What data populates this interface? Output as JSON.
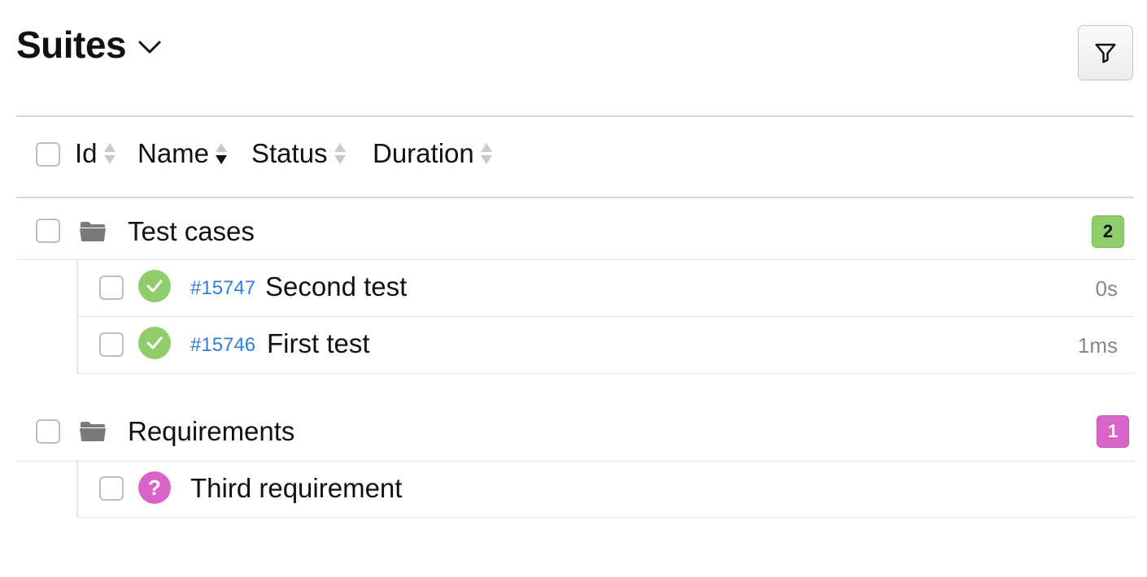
{
  "header": {
    "title": "Suites",
    "filter_icon": "filter-icon",
    "chevron_icon": "chevron-down-icon"
  },
  "columns": [
    {
      "label": "Id",
      "sort": "none"
    },
    {
      "label": "Name",
      "sort": "descending"
    },
    {
      "label": "Status",
      "sort": "none"
    },
    {
      "label": "Duration",
      "sort": "none"
    }
  ],
  "groups": [
    {
      "label": "Test cases",
      "count": "2",
      "badge_color": "#8fcd6a",
      "items": [
        {
          "id": "#15747",
          "name": "Second test",
          "status": "passed",
          "duration": "0s"
        },
        {
          "id": "#15746",
          "name": "First test",
          "status": "passed",
          "duration": "1ms"
        }
      ]
    },
    {
      "label": "Requirements",
      "count": "1",
      "badge_color": "#d864c7",
      "items": [
        {
          "id": "",
          "name": "Third requirement",
          "status": "unknown",
          "status_glyph": "?",
          "duration": ""
        }
      ]
    }
  ],
  "colors": {
    "passed": "#8fcd6a",
    "requirement": "#d864c7",
    "link": "#2f7fd6"
  }
}
